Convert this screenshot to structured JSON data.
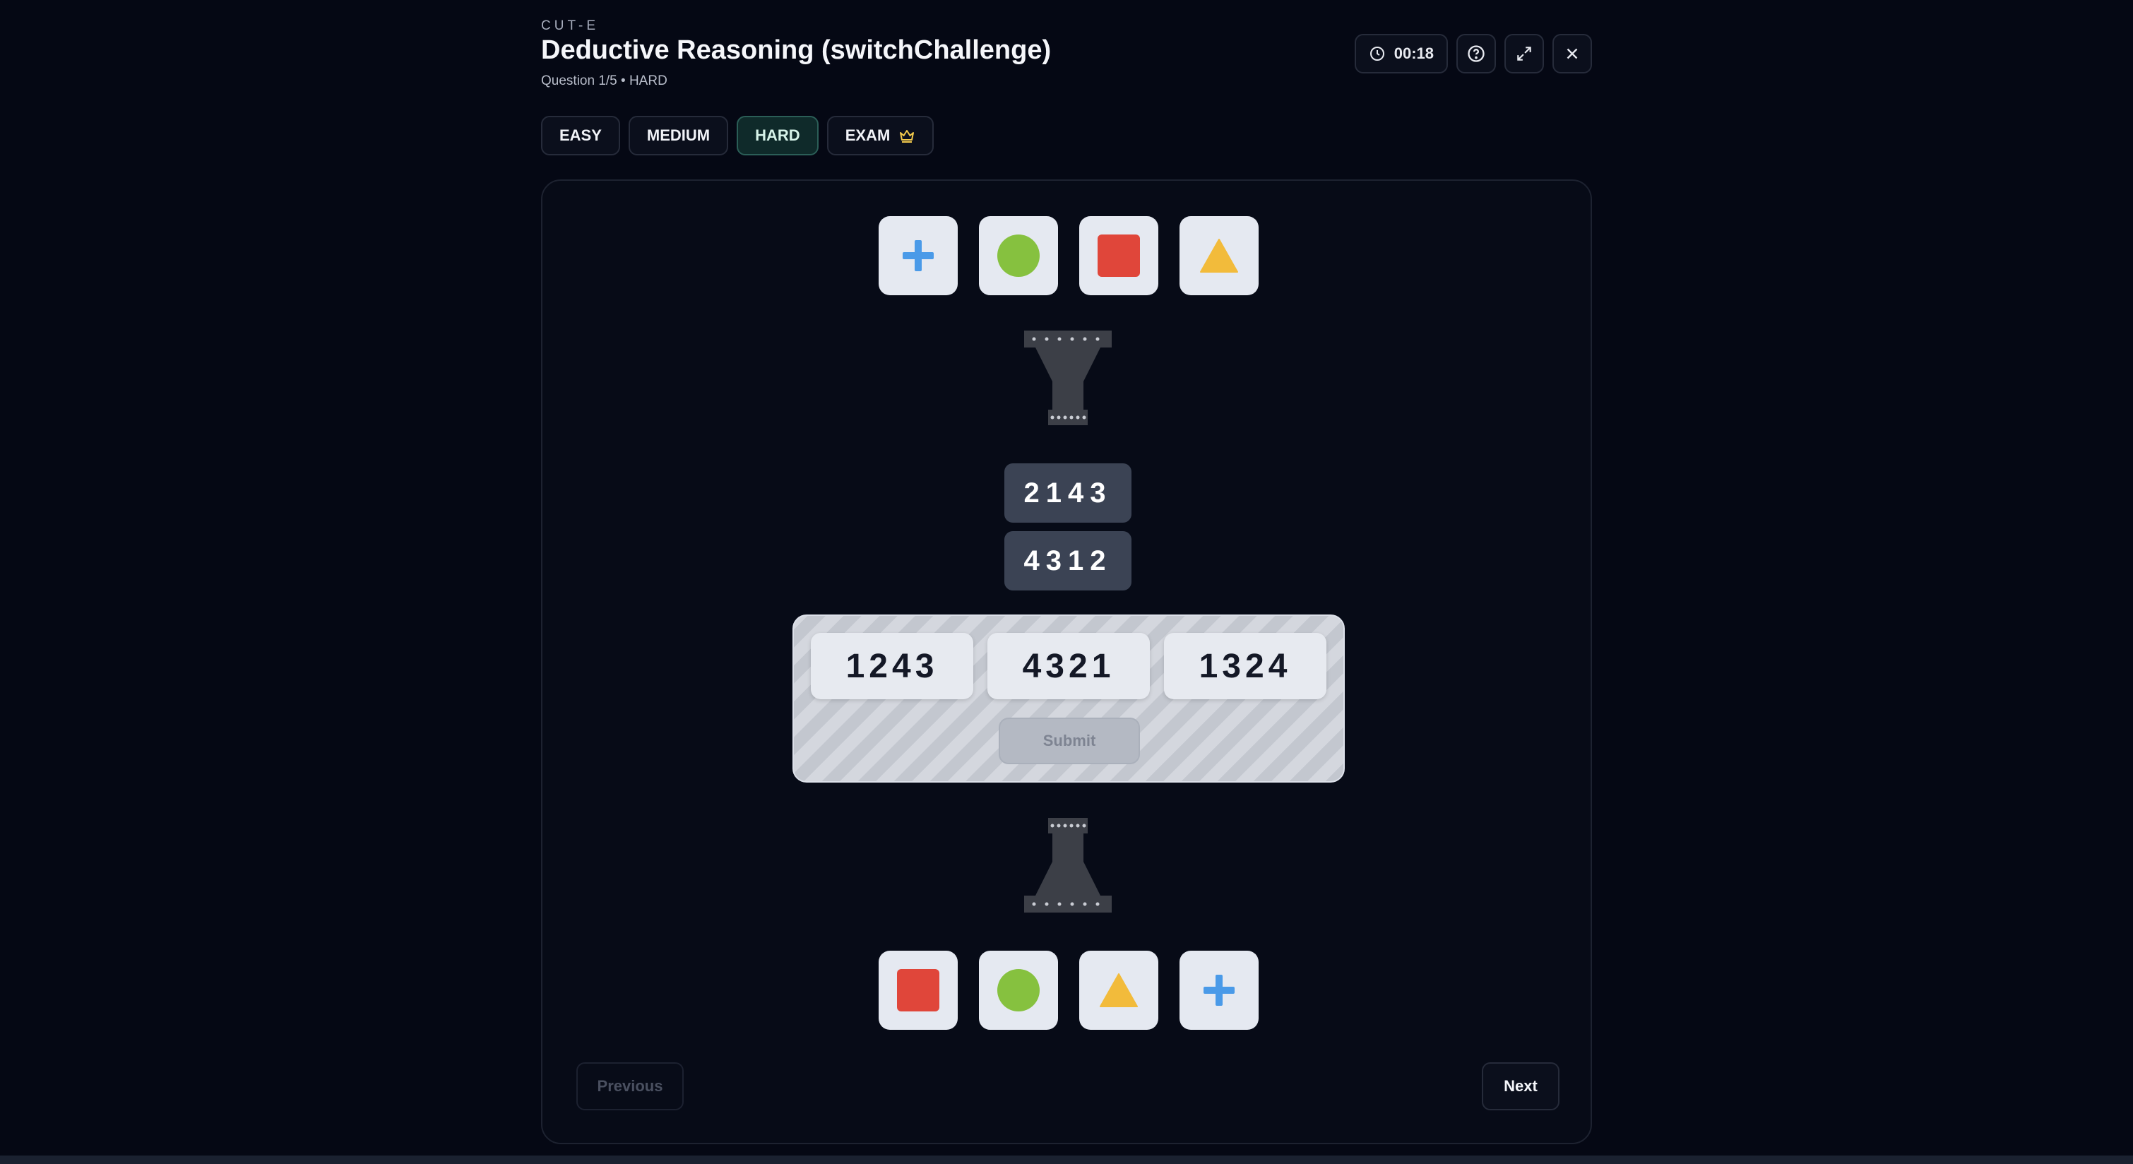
{
  "header": {
    "eyebrow": "CUT-E",
    "title": "Deductive Reasoning (switchChallenge)",
    "subtitle": "Question 1/5 • HARD"
  },
  "controls": {
    "timer": "00:18",
    "timer_icon": "clock-icon",
    "help_icon": "help-circle-icon",
    "fullscreen_icon": "expand-icon",
    "close_icon": "close-icon"
  },
  "difficulty_tabs": [
    {
      "label": "EASY",
      "active": false
    },
    {
      "label": "MEDIUM",
      "active": false
    },
    {
      "label": "HARD",
      "active": true
    },
    {
      "label": "EXAM",
      "active": false,
      "icon": "crown-icon"
    }
  ],
  "puzzle": {
    "input_shapes": [
      "plus",
      "circle",
      "square",
      "triangle"
    ],
    "applied_codes": [
      "2143",
      "4312"
    ],
    "options": [
      "1243",
      "4321",
      "1324"
    ],
    "submit_label": "Submit",
    "output_shapes": [
      "square",
      "circle",
      "triangle",
      "plus"
    ]
  },
  "navigation": {
    "previous_label": "Previous",
    "next_label": "Next"
  },
  "colors": {
    "background": "#050814",
    "plus": "#4a9ae8",
    "circle": "#86c13f",
    "square": "#e0463a",
    "triangle": "#f2bb3b",
    "active_tab": "#0f2a2a"
  }
}
